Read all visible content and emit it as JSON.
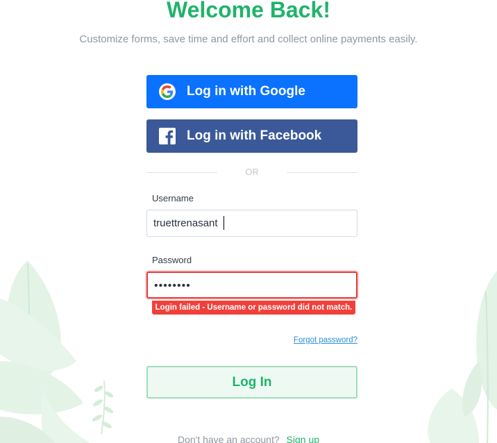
{
  "header": {
    "title": "Welcome Back!",
    "subtitle": "Customize forms, save time and effort and collect online payments easily."
  },
  "social": {
    "google_label": "Log in with Google",
    "facebook_label": "Log in with Facebook"
  },
  "divider_text": "OR",
  "form": {
    "username_label": "Username",
    "username_value": "truettrenasant",
    "password_label": "Password",
    "password_value": "••••••••",
    "error_message": "Login failed - Username or password did not match.",
    "forgot_password": "Forgot password?",
    "login_button": "Log In"
  },
  "signup": {
    "prompt": "Don't have an account?",
    "link": "Sign up"
  },
  "colors": {
    "brand_green": "#1fb36a",
    "google_blue": "#0a72ff",
    "facebook_blue": "#3b5998",
    "error_red": "#f1403a"
  }
}
